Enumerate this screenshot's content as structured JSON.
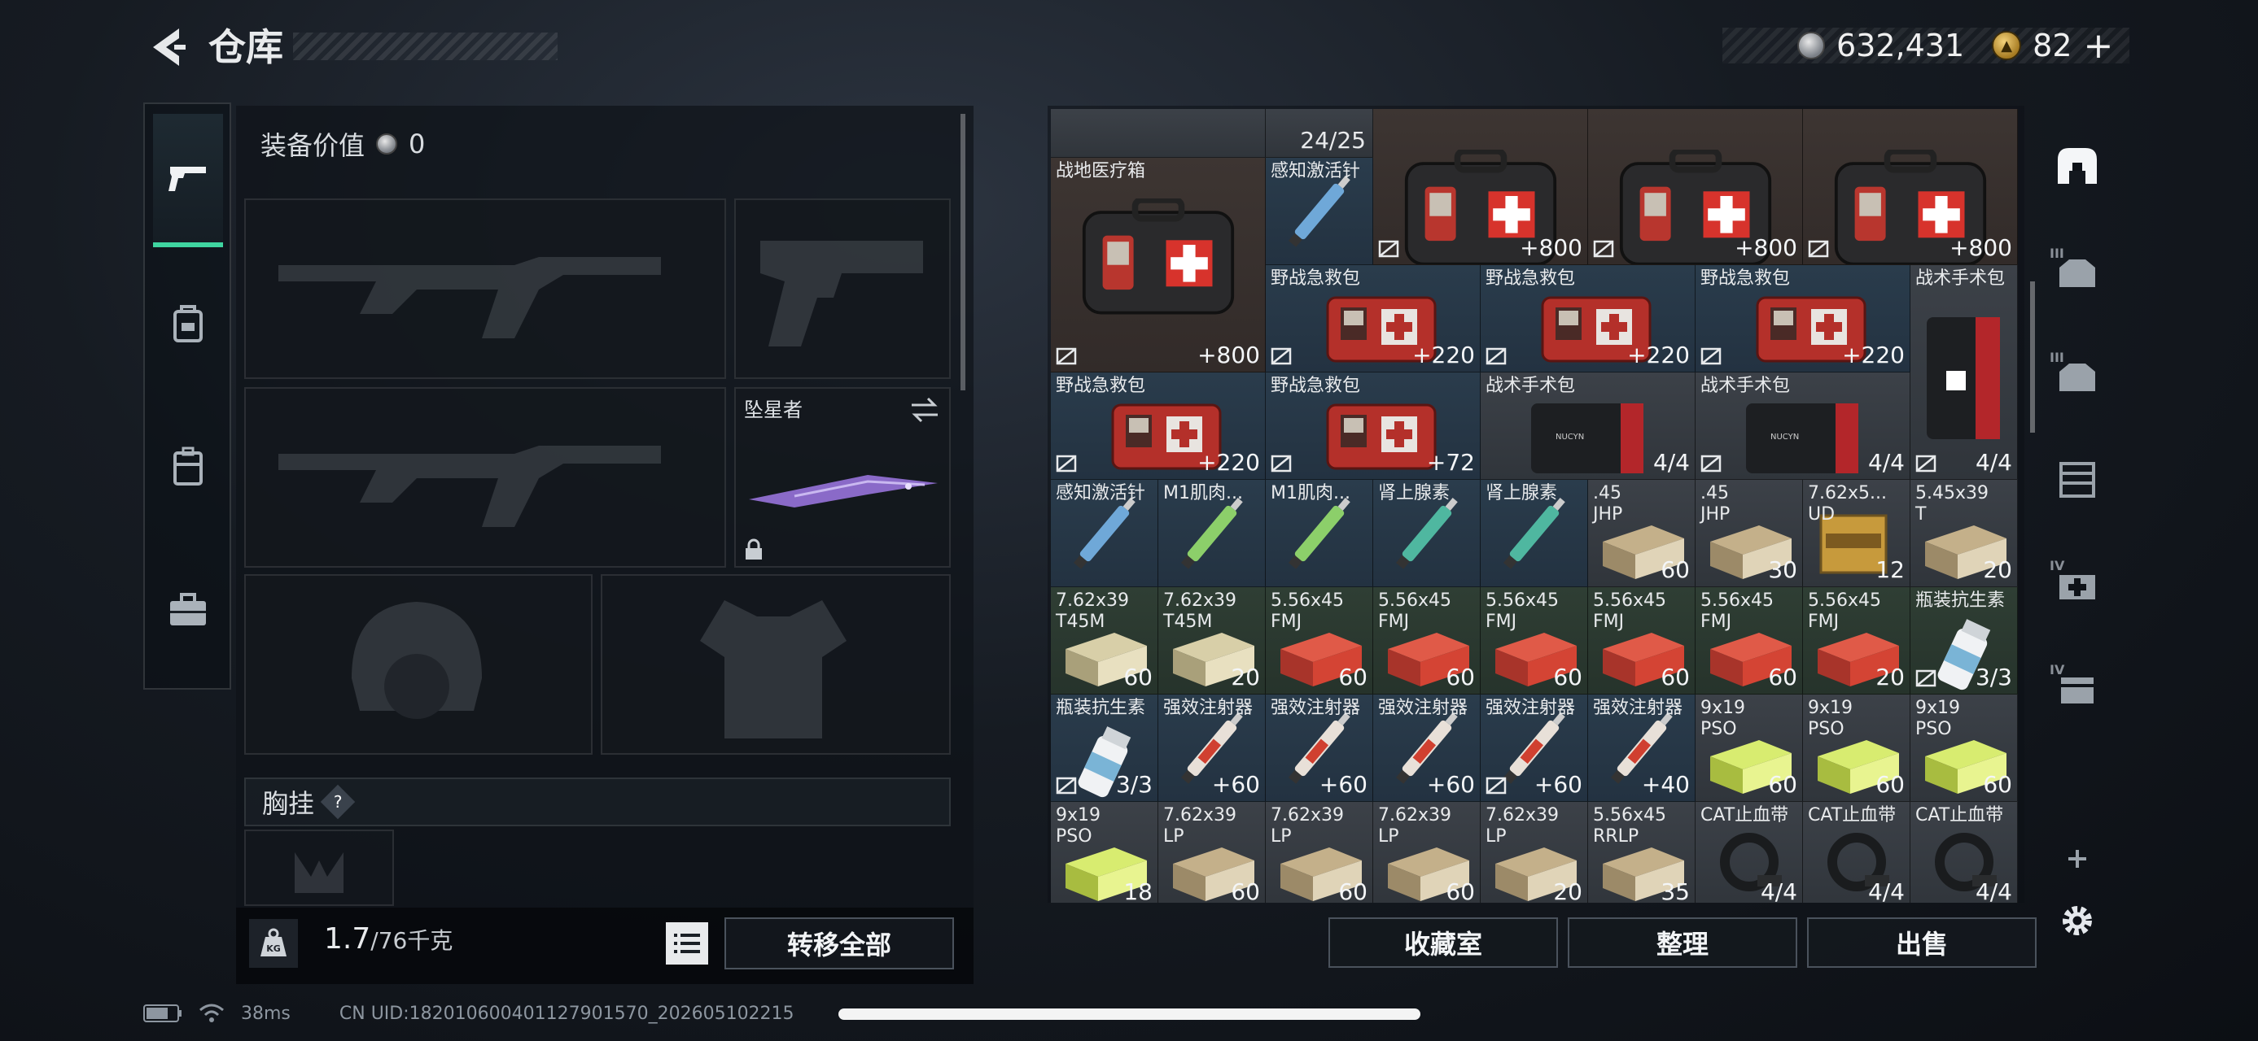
{
  "header": {
    "title": "仓库",
    "currency_silver": "632,431",
    "currency_gold": "82",
    "gold_plus": "+"
  },
  "equipment": {
    "value_label": "装备价值",
    "value": "0",
    "melee_name": "坠星者",
    "chest_label": "胸挂",
    "chest_help": "?",
    "weight_unit_icon": "KG",
    "weight_current": "1.7",
    "weight_max": "/76千克",
    "transfer_all": "转移全部"
  },
  "inventory": {
    "capacity": "24/25",
    "cells": [
      {
        "name": "战地医疗箱",
        "qty": "+800"
      },
      {
        "name": "感知激活针",
        "qty": ""
      },
      {
        "name": "",
        "qty": "+800"
      },
      {
        "name": "",
        "qty": "+800"
      },
      {
        "name": "",
        "qty": "+800"
      },
      {
        "name": "野战急救包",
        "qty": "+220"
      },
      {
        "name": "野战急救包",
        "qty": "+220"
      },
      {
        "name": "野战急救包",
        "qty": "+220"
      },
      {
        "name": "战术手术包",
        "qty": "4/4"
      },
      {
        "name": "野战急救包",
        "qty": "+220"
      },
      {
        "name": "野战急救包",
        "qty": "+72"
      },
      {
        "name": "战术手术包",
        "qty": "4/4"
      },
      {
        "name": "战术手术包",
        "qty": "4/4"
      },
      {
        "name": "感知激活针",
        "qty": ""
      },
      {
        "name": "M1肌肉...",
        "qty": ""
      },
      {
        "name": "M1肌肉...",
        "qty": ""
      },
      {
        "name": "肾上腺素",
        "qty": ""
      },
      {
        "name": "肾上腺素",
        "qty": ""
      },
      {
        "name": ".45\nJHP",
        "qty": "60"
      },
      {
        "name": ".45\nJHP",
        "qty": "30"
      },
      {
        "name": "7.62x5...\nUD",
        "qty": "12"
      },
      {
        "name": "5.45x39\nT",
        "qty": "20"
      },
      {
        "name": "7.62x39\nT45M",
        "qty": "60"
      },
      {
        "name": "7.62x39\nT45M",
        "qty": "20"
      },
      {
        "name": "5.56x45\nFMJ",
        "qty": "60"
      },
      {
        "name": "5.56x45\nFMJ",
        "qty": "60"
      },
      {
        "name": "5.56x45\nFMJ",
        "qty": "60"
      },
      {
        "name": "5.56x45\nFMJ",
        "qty": "60"
      },
      {
        "name": "5.56x45\nFMJ",
        "qty": "60"
      },
      {
        "name": "5.56x45\nFMJ",
        "qty": "20"
      },
      {
        "name": "瓶装抗生素",
        "qty": "3/3"
      },
      {
        "name": "瓶装抗生素",
        "qty": "3/3"
      },
      {
        "name": "强效注射器",
        "qty": "+60"
      },
      {
        "name": "强效注射器",
        "qty": "+60"
      },
      {
        "name": "强效注射器",
        "qty": "+60"
      },
      {
        "name": "强效注射器",
        "qty": "+60"
      },
      {
        "name": "强效注射器",
        "qty": "+40"
      },
      {
        "name": "9x19\nPSO",
        "qty": "60"
      },
      {
        "name": "9x19\nPSO",
        "qty": "60"
      },
      {
        "name": "9x19\nPSO",
        "qty": "60"
      },
      {
        "name": "9x19\nPSO",
        "qty": "18"
      },
      {
        "name": "7.62x39\nLP",
        "qty": "60"
      },
      {
        "name": "7.62x39\nLP",
        "qty": "60"
      },
      {
        "name": "7.62x39\nLP",
        "qty": "60"
      },
      {
        "name": "7.62x39\nLP",
        "qty": "20"
      },
      {
        "name": "5.56x45\nRRLP",
        "qty": "35"
      },
      {
        "name": "CAT止血带",
        "qty": "4/4"
      },
      {
        "name": "CAT止血带",
        "qty": "4/4"
      },
      {
        "name": "CAT止血带",
        "qty": "4/4"
      }
    ],
    "buttons": {
      "collection": "收藏室",
      "sort": "整理",
      "sell": "出售"
    }
  },
  "categories": [
    {
      "icon": "safe-box-icon",
      "numeral": ""
    },
    {
      "icon": "armor-tier3-icon",
      "numeral": "III"
    },
    {
      "icon": "armor-tier3b-icon",
      "numeral": "III"
    },
    {
      "icon": "rig-icon",
      "numeral": ""
    },
    {
      "icon": "medkit-tier4-icon",
      "numeral": "IV"
    },
    {
      "icon": "ammo-tier4-icon",
      "numeral": "IV"
    },
    {
      "icon": "plus-icon",
      "numeral": ""
    },
    {
      "icon": "gear-icon",
      "numeral": ""
    }
  ],
  "status": {
    "ping": "38ms",
    "uid": "CN UID:1820106004011279015​70_20260510​2215"
  }
}
